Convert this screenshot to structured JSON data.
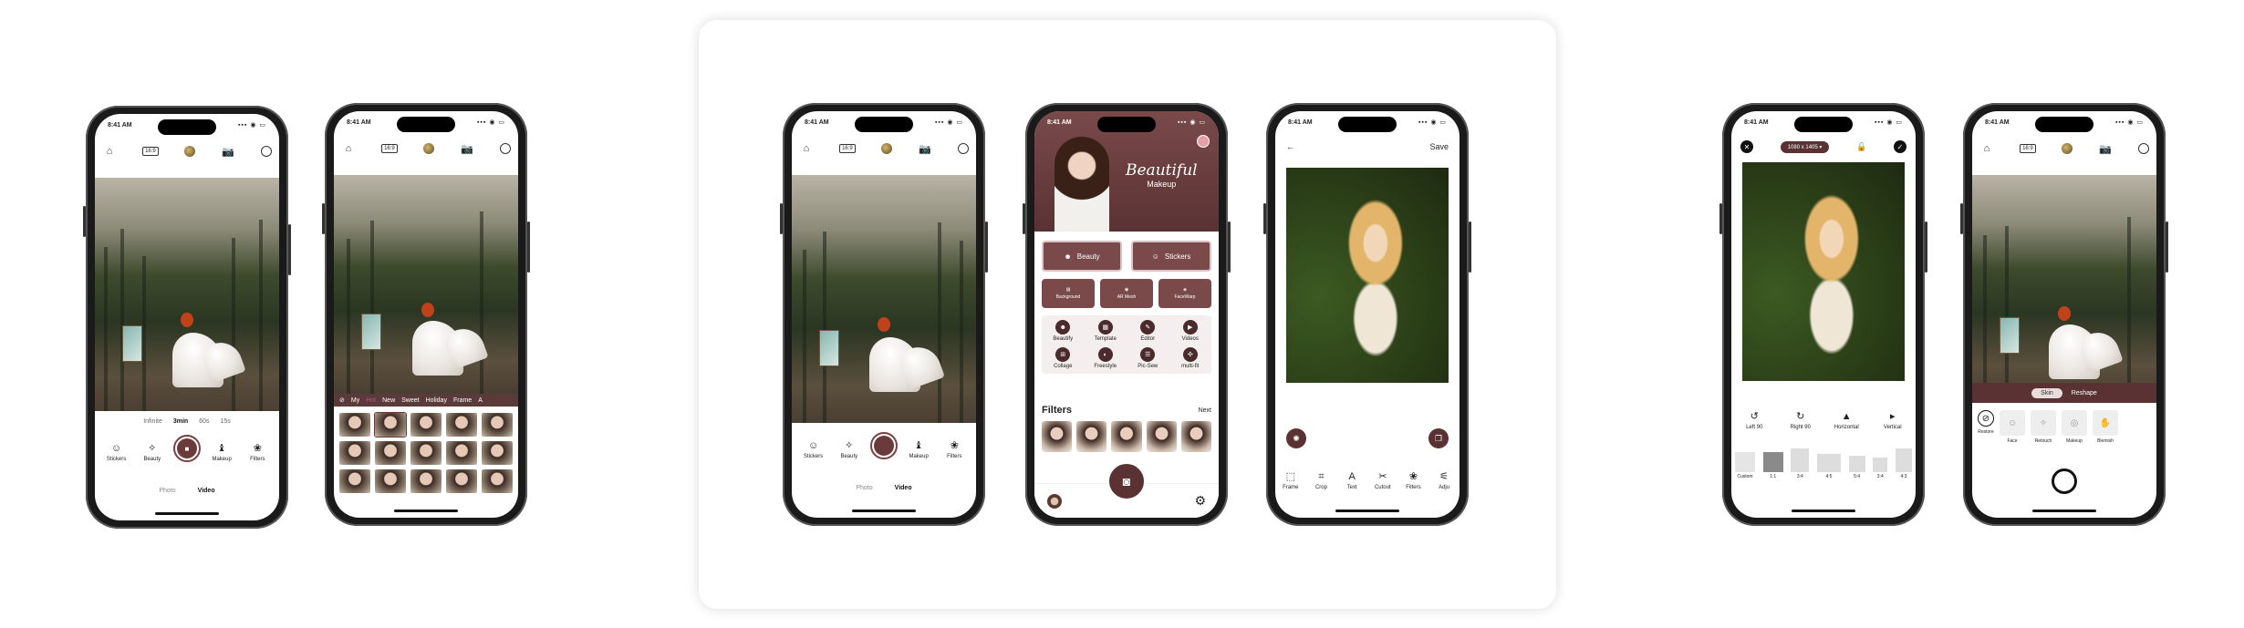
{
  "status_time": "8:41 AM",
  "status_icons": "▪▪▪ ◉ ▭",
  "topbar": {
    "ratio": "16:9"
  },
  "capture_hints": {
    "items": [
      "Infinite",
      "3min",
      "60s",
      "15s"
    ],
    "active": "3min"
  },
  "camera_tools": {
    "stickers": "Stickers",
    "beauty": "Beauty",
    "makeup": "Makeup",
    "filters": "Filters"
  },
  "modes": {
    "photo": "Photo",
    "video": "Video"
  },
  "filter_tabs": [
    "My",
    "Hot",
    "New",
    "Sweet",
    "Holiday",
    "Frame",
    "A"
  ],
  "makeup_home": {
    "title": "Beautiful",
    "subtitle": "Makeup",
    "beauty": "Beauty",
    "stickers": "Stickers",
    "background": "Background",
    "ar_mesh": "AR Mesh",
    "facewarp": "FaceWarp",
    "grid": [
      "Beautify",
      "Template",
      "Editor",
      "Videos",
      "Collage",
      "Freestyle",
      "Pic-Sew",
      "multi-fit"
    ],
    "filters_title": "Filters",
    "next": "Next"
  },
  "editor": {
    "save": "Save",
    "tools": [
      "Frame",
      "Crop",
      "Text",
      "Cutout",
      "Filters",
      "Adju"
    ]
  },
  "crop": {
    "dimensions": "1080 x 1405",
    "rotations": [
      "Left 90",
      "Right 90",
      "Horizontal",
      "Vertical"
    ],
    "ratios": [
      "Custom",
      "1:1",
      "3:4",
      "4:5",
      "5:4",
      "3:4",
      "4:3",
      "A4"
    ],
    "rot_icons": [
      "↺",
      "↻",
      "▲",
      "▸"
    ]
  },
  "skin": {
    "tabs": [
      "Skin",
      "Reshape"
    ],
    "restore": "Restore",
    "tools": [
      "Face",
      "Retouch",
      "Makeup",
      "Blemish"
    ]
  },
  "colors": {
    "brand": "#5a3233",
    "accent": "#7a4a4b"
  }
}
